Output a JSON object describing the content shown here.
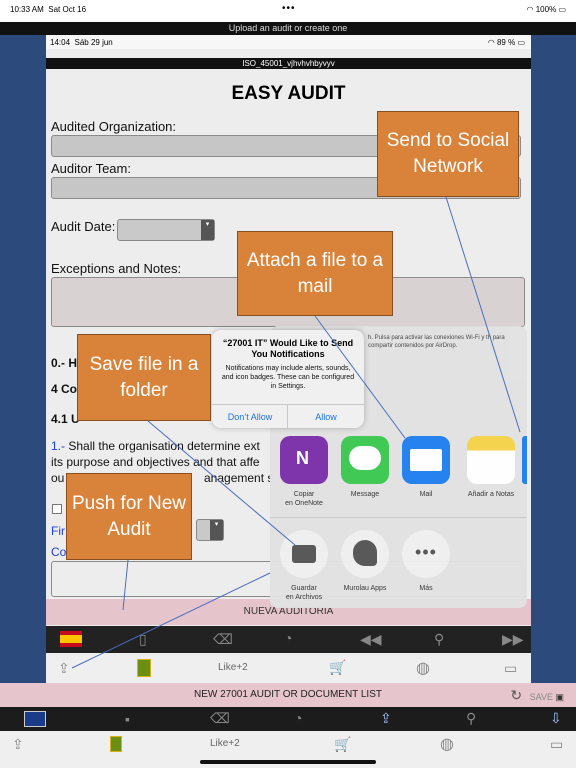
{
  "outer_status": {
    "time": "10:33 AM",
    "date": "Sat Oct 16",
    "battery": "100%"
  },
  "top_banner": "Upload an audit or create one",
  "inner_status": {
    "time": "14:04",
    "date": "Sáb 29 jun",
    "battery": "89 %"
  },
  "inner_title": "ISO_45001_vjhvhvhbyvyv",
  "app_title": "EASY AUDIT",
  "form": {
    "audited_org_label": "Audited Organization:",
    "auditor_team_label": "Auditor Team:",
    "audit_date_label": "Audit Date:",
    "exceptions_label": "Exceptions and Notes:"
  },
  "content": {
    "section0": "0.- H",
    "section4": "4 Co",
    "section41": "4.1 U",
    "q1_num": "1.-",
    "q1_line1": "Shall the organisation determine ext",
    "q1_line2": "its purpose and objectives and that affe",
    "q1_line3": "ou",
    "q1_line3b": "anagement s",
    "fir": "Fir",
    "co": "Co"
  },
  "nueva_auditoria": "NUEVA AUDITORIA",
  "inner_toolbar2": {
    "like": "Like+2"
  },
  "share_sheet": {
    "info": "h. Pulsa para activar las conexiones Wi-Fi y th para compartir contenidos por AirDrop.",
    "apps": [
      {
        "caption_1": "Copiar",
        "caption_2": "en OneNote",
        "color": "#7b2fa8"
      },
      {
        "caption_1": "Message",
        "caption_2": "",
        "color": "#3cc852"
      },
      {
        "caption_1": "Mail",
        "caption_2": "",
        "color": "#1f7ff0"
      },
      {
        "caption_1": "Añadir a Notas",
        "caption_2": "",
        "color": "#f5d34a"
      }
    ],
    "actions": [
      {
        "caption_1": "Guardar",
        "caption_2": "en Archivos"
      },
      {
        "caption_1": "Murolau Apps",
        "caption_2": ""
      },
      {
        "caption_1": "Más",
        "caption_2": ""
      }
    ]
  },
  "alert": {
    "title": "“27001 IT” Would Like to Send You Notifications",
    "message": "Notifications may include alerts, sounds, and icon badges. These can be configured in Settings.",
    "dont_allow": "Don’t Allow",
    "allow": "Allow"
  },
  "callouts": {
    "social": "Send to Social Network",
    "mail": "Attach a file to a mail",
    "folder": "Save file in a folder",
    "new_audit": "Push for New Audit"
  },
  "outer_pink": {
    "title": "NEW 27001 AUDIT OR DOCUMENT LIST",
    "save": "SAVE"
  },
  "outer_toolbar2": {
    "like": "Like+2"
  },
  "colors": {
    "callout": "#d9823a",
    "pink_bar": "#e7c5cc",
    "background": "#2c4a7c"
  }
}
